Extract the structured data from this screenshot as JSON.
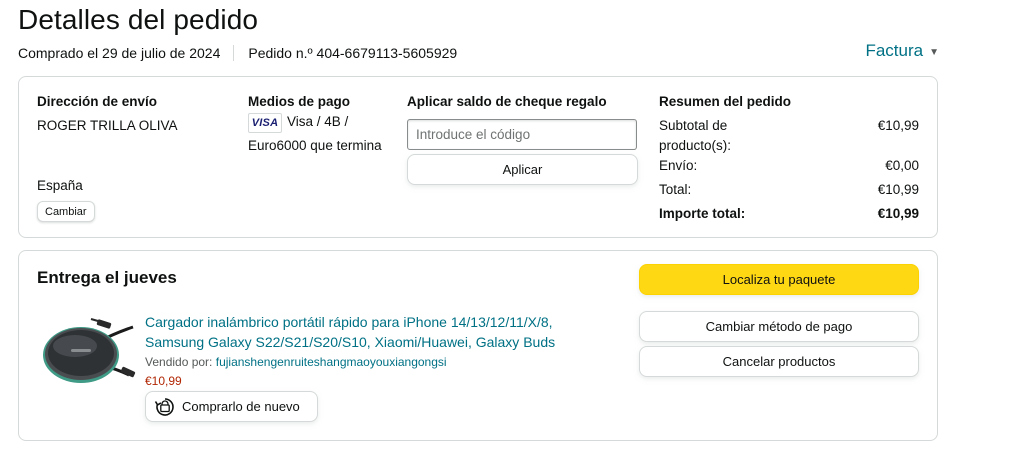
{
  "header": {
    "title": "Detalles del pedido",
    "purchased": "Comprado el 29 de julio de 2024",
    "order_number": "Pedido n.º 404-6679113-5605929",
    "invoice_label": "Factura"
  },
  "shipping": {
    "title": "Dirección de envío",
    "name": "ROGER TRILLA OLIVA",
    "country": "España",
    "change_label": "Cambiar"
  },
  "payment": {
    "title": "Medios de pago",
    "card_brand": "VISA",
    "line1": "Visa / 4B /",
    "line2": "Euro6000 que termina"
  },
  "gift": {
    "title": "Aplicar saldo de cheque regalo",
    "placeholder": "Introduce el código",
    "apply_label": "Aplicar"
  },
  "summary": {
    "title": "Resumen del pedido",
    "subtotal_label_1": "Subtotal de",
    "subtotal_label_2": "producto(s):",
    "subtotal_value": "€10,99",
    "shipping_label": "Envío:",
    "shipping_value": "€0,00",
    "total_label": "Total:",
    "total_value": "€10,99",
    "grand_total_label": "Importe total:",
    "grand_total_value": "€10,99"
  },
  "delivery": {
    "title": "Entrega el jueves",
    "product_title_line1": "Cargador inalámbrico portátil rápido para iPhone 14/13/12/11/X/8,",
    "product_title_line2": "Samsung Galaxy S22/S21/S20/S10, Xiaomi/Huawei, Galaxy Buds",
    "sold_by_label": "Vendido por:",
    "seller": "fujianshengenruiteshangmaoyouxiangongsi",
    "price": "€10,99",
    "rebuy_label": "Comprarlo de nuevo",
    "track_label": "Localiza tu paquete",
    "change_payment_label": "Cambiar método de pago",
    "cancel_label": "Cancelar productos"
  },
  "colors": {
    "link": "#007185",
    "price": "#b12704",
    "primary_button": "#ffd814",
    "border": "#d5d9d9"
  },
  "icons": {
    "invoice_chevron": "chevron-down-icon",
    "rebuy": "rebuy-icon",
    "card": "visa-icon"
  }
}
